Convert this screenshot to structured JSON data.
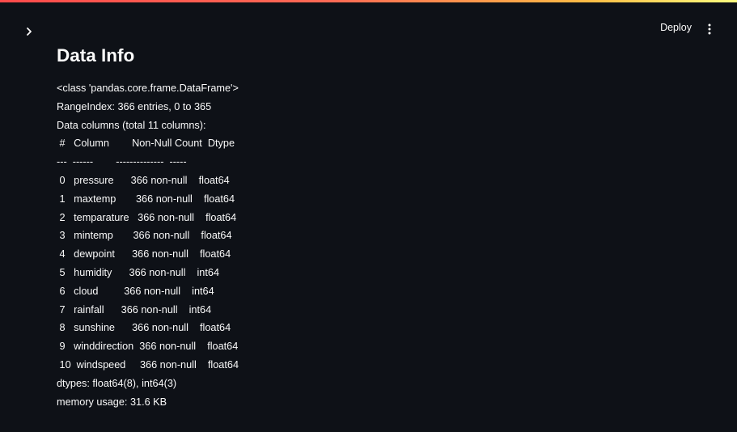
{
  "header": {
    "deploy_label": "Deploy"
  },
  "icons": {
    "sidebar_toggle": "chevron-right-icon",
    "main_menu": "vertical-ellipsis-icon"
  },
  "page": {
    "title": "Data Info"
  },
  "info": {
    "class_line": "<class 'pandas.core.frame.DataFrame'>",
    "range_index": "RangeIndex: 366 entries, 0 to 365",
    "data_columns": "Data columns (total 11 columns):",
    "header_line": " #   Column        Non-Null Count  Dtype",
    "separator_line": "---  ------        --------------  -----",
    "rows": [
      " 0   pressure      366 non-null    float64",
      " 1   maxtemp       366 non-null    float64",
      " 2   temparature   366 non-null    float64",
      " 3   mintemp       366 non-null    float64",
      " 4   dewpoint      366 non-null    float64",
      " 5   humidity      366 non-null    int64",
      " 6   cloud         366 non-null    int64",
      " 7   rainfall      366 non-null    int64",
      " 8   sunshine      366 non-null    float64",
      " 9   winddirection  366 non-null    float64",
      " 10  windspeed     366 non-null    float64"
    ],
    "dtypes": "dtypes: float64(8), int64(3)",
    "memory": "memory usage: 31.6 KB"
  }
}
